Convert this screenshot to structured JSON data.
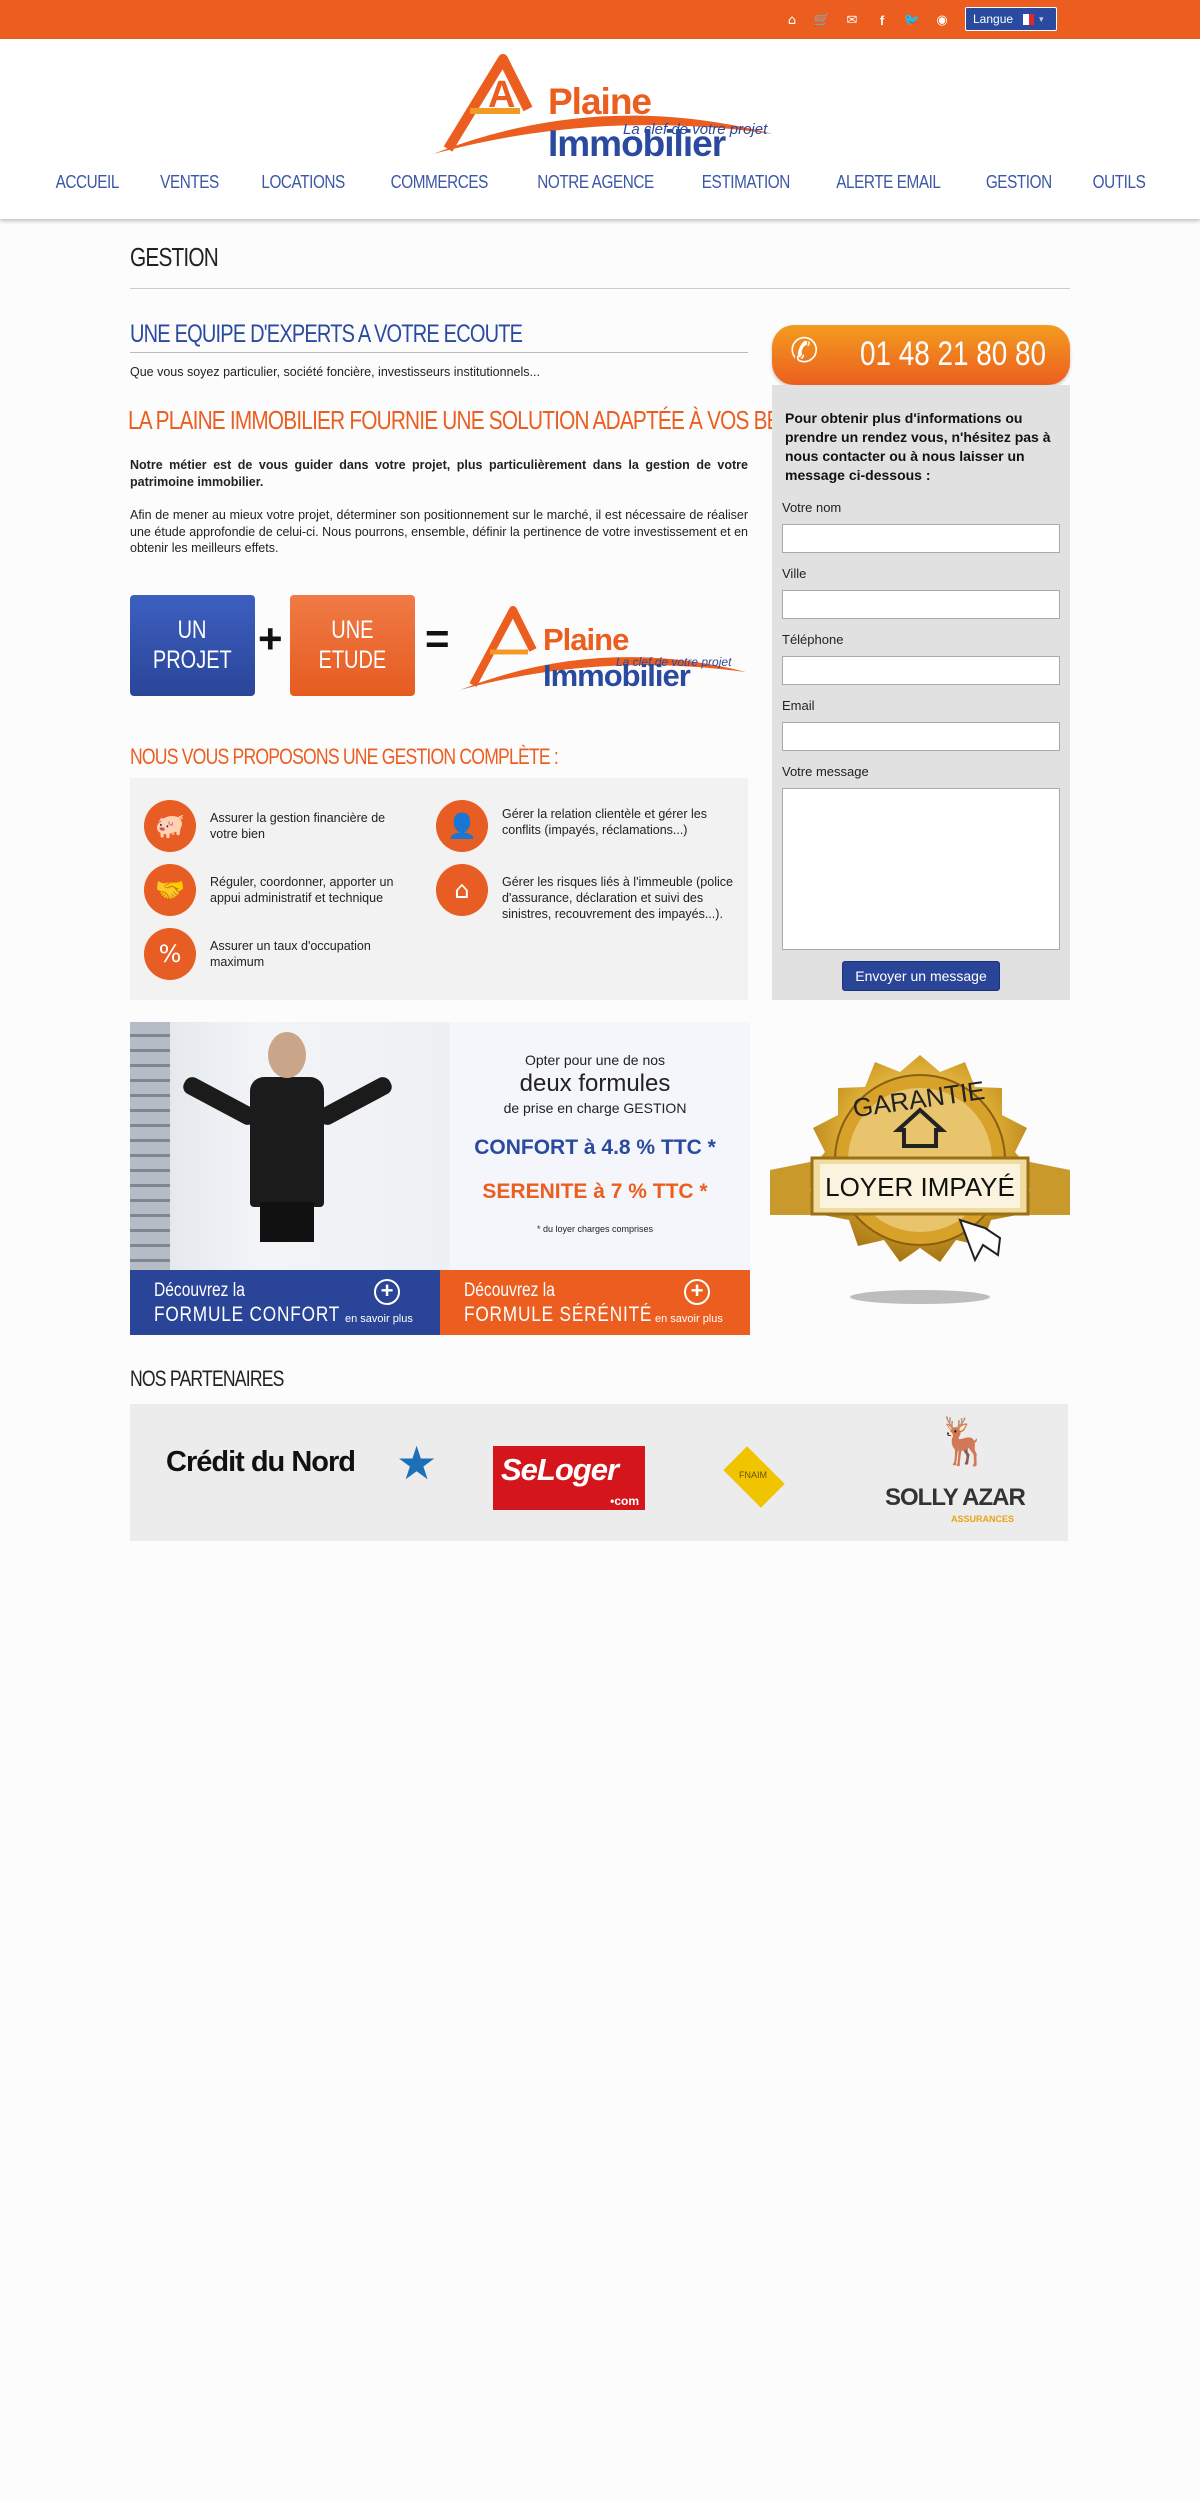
{
  "topbar": {
    "icons": [
      "home-icon",
      "cart-icon",
      "mail-icon",
      "facebook-icon",
      "twitter-icon",
      "rss-icon"
    ],
    "language_label": "Langue"
  },
  "brand": {
    "name_part1": "Plaine",
    "name_part2": "Immobilier",
    "tagline": "La clef de votre projet"
  },
  "nav": [
    "ACCUEIL",
    "VENTES",
    "LOCATIONS",
    "COMMERCES",
    "NOTRE AGENCE",
    "ESTIMATION",
    "ALERTE EMAIL",
    "GESTION",
    "OUTILS"
  ],
  "page": {
    "title": "GESTION",
    "section1_heading": "UNE EQUIPE D'EXPERTS A VOTRE ECOUTE",
    "section1_text": "Que vous soyez particulier, société foncière, investisseurs institutionnels...",
    "section2_heading": "LA PLAINE IMMOBILIER FOURNIE UNE SOLUTION ADAPTÉE À VOS BESOINS.",
    "para1": "Notre métier est de vous guider dans votre projet, plus particulièrement dans la gestion de votre patrimoine immobilier.",
    "para2": "Afin de mener au mieux votre projet, déterminer son positionnement sur le marché, il est nécessaire de réaliser une étude approfondie de celui-ci. Nous pourrons, ensemble, définir la pertinence de votre investissement et en obtenir les meilleurs effets.",
    "equation": {
      "box1": [
        "UN",
        "PROJET"
      ],
      "box2": [
        "UNE",
        "ETUDE"
      ],
      "plus": "+",
      "equals": "="
    },
    "services_heading": "NOUS VOUS PROPOSONS UNE GESTION COMPLÈTE :",
    "services": [
      "Assurer la gestion financière de votre bien",
      "Réguler, coordonner, apporter un appui administratif et technique",
      "Assurer un taux d'occupation maximum",
      "Gérer la relation clientèle et gérer les conflits (impayés, réclamations...)",
      "Gérer les risques liés à l'immeuble (police d'assurance, déclaration et suivi des sinistres, recouvrement des impayés...)."
    ],
    "services_icons": [
      "piggy-bank-icon",
      "handshake-icon",
      "percent-house-icon",
      "person-icon",
      "house-icon"
    ]
  },
  "banner": {
    "line1": "Opter pour une de nos",
    "line2": "deux formules",
    "line3": "de prise en charge GESTION",
    "confort": "CONFORT à 4.8 % TTC *",
    "serenite": "SERENITE à 7 % TTC *",
    "note": "* du loyer charges comprises",
    "cta1_top": "Découvrez la",
    "cta1_bottom": "FORMULE CONFORT",
    "cta2_top": "Découvrez la",
    "cta2_bottom": "FORMULE SÉRÉNITÉ",
    "more": "en savoir plus"
  },
  "contact": {
    "phone": "01 48 21 80 80",
    "intro": "Pour obtenir plus d'informations ou prendre un rendez vous, n'hésitez pas à nous contacter ou à nous laisser un message ci-dessous :",
    "fields": [
      "Votre nom",
      "Ville",
      "Téléphone",
      "Email",
      "Votre message"
    ],
    "submit": "Envoyer un message"
  },
  "badge": {
    "line1": "GARANTIE",
    "line2": "LOYER IMPAYÉ"
  },
  "partners": {
    "heading": "NOS PARTENAIRES",
    "credit_du_nord": "Crédit du Nord",
    "seloger": "SeLoger",
    "seloger_suffix": "•com",
    "fnaim": "FNAIM",
    "solly_azar": "SOLLY AZAR",
    "solly_sub": "ASSURANCES"
  },
  "colors": {
    "orange": "#ec5e1f",
    "blue": "#2a4a9f"
  }
}
